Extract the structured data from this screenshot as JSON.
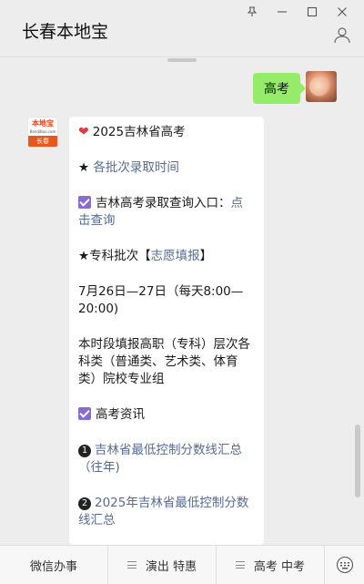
{
  "window": {
    "controls": {
      "pin": "⊼",
      "minimize": "—",
      "maximize": "☐",
      "close": "✕"
    }
  },
  "header": {
    "title": "长春本地宝"
  },
  "messages": {
    "outgoing": {
      "text": "高考"
    },
    "official_account": {
      "logo": {
        "top": "本地宝",
        "mid": "BendiBao.com",
        "bottom": "长春"
      }
    },
    "article": {
      "title": "2025吉林省高考",
      "star_link": "各批次录取时间",
      "query_label": "吉林高考录取查询入口：",
      "query_link": "点击查询",
      "zhuanke_prefix": "★专科批次【",
      "zhuanke_link": "志愿填报",
      "zhuanke_suffix": "】",
      "date_text": "7月26日—27日（每天8:00—20:00)",
      "desc_text": "本时段填报高职（专科）层次各科类（普通类、艺术类、体育类）院校专业组",
      "news_label": "高考资讯",
      "item1_num": "1",
      "item1_link": "吉林省最低控制分数线汇总（往年)",
      "item2_num": "2",
      "item2_link": "2025年吉林省最低控制分数线汇总"
    }
  },
  "bottom_menu": {
    "items": [
      {
        "label": "微信办事"
      },
      {
        "label": "演出 特惠"
      },
      {
        "label": "高考 中考"
      }
    ]
  },
  "colors": {
    "outgoing_bubble": "#95ec69",
    "link": "#576b95",
    "check_badge": "#8a6bd1",
    "heart": "#e5383b",
    "logo_orange": "#e8581c"
  }
}
